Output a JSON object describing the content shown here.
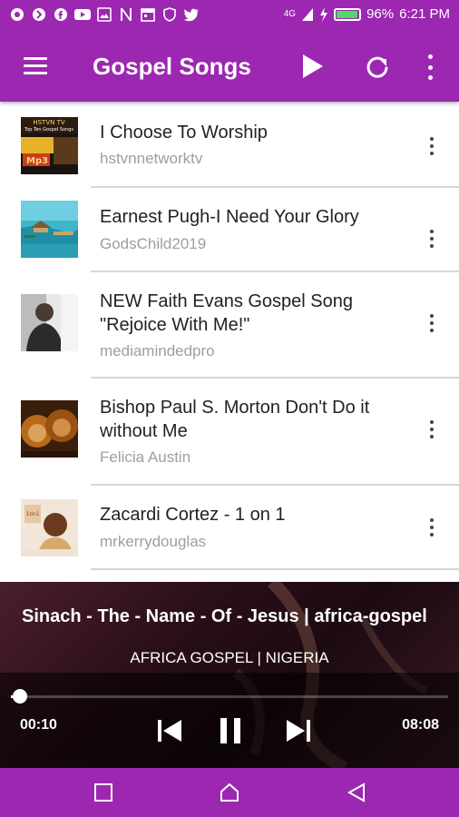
{
  "status_bar": {
    "left_icons": [
      "opera-icon",
      "shazam-icon",
      "facebook-icon",
      "youtube-icon",
      "gallery-icon",
      "news-icon",
      "calendar-icon",
      "shield-icon",
      "twitter-icon"
    ],
    "network": "4G",
    "battery_percent": "96%",
    "battery_level": 0.96,
    "time": "6:21 PM"
  },
  "app_bar": {
    "title": "Gospel Songs",
    "color": "#9c27b0"
  },
  "songs": [
    {
      "title": "I Choose To Worship",
      "channel": "hstvnnetworktv",
      "thumb": "hstvn-thumbnail"
    },
    {
      "title": "Earnest Pugh-I Need Your Glory",
      "channel": "GodsChild2019",
      "thumb": "island-thumbnail"
    },
    {
      "title": "NEW Faith Evans Gospel Song \"Rejoice With Me!\"",
      "channel": "mediamindedpro",
      "thumb": "portrait-thumbnail"
    },
    {
      "title": "Bishop Paul S. Morton Don't Do it without Me",
      "channel": "Felicia Austin",
      "thumb": "lions-thumbnail"
    },
    {
      "title": "Zacardi Cortez - 1 on 1",
      "channel": "mrkerrydouglas",
      "thumb": "cortez-thumbnail"
    }
  ],
  "player": {
    "now_playing": "Sinach - The - Name - Of - Jesus | africa-gospel",
    "station": "AFRICA GOSPEL | NIGERIA",
    "current_time": "00:10",
    "duration": "08:08",
    "progress": 0.02
  }
}
